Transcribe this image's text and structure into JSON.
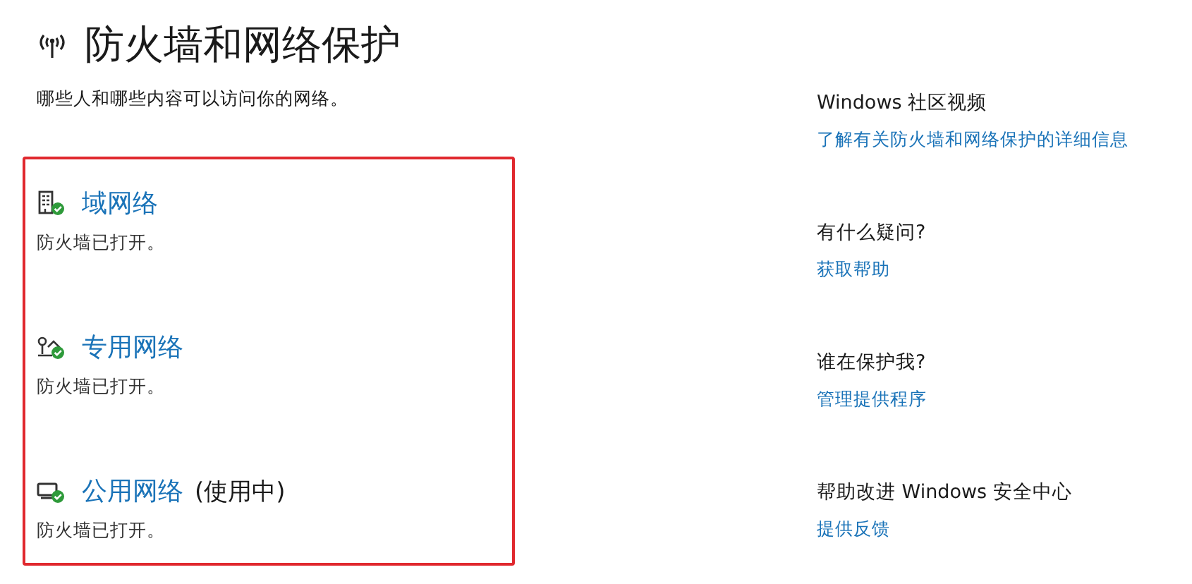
{
  "header": {
    "title": "防火墙和网络保护",
    "subtitle": "哪些人和哪些内容可以访问你的网络。"
  },
  "networks": [
    {
      "kind": "building",
      "name": "域网络",
      "status": "防火墙已打开。",
      "protected": true
    },
    {
      "kind": "home",
      "name": "专用网络",
      "status": "防火墙已打开。",
      "protected": true
    },
    {
      "kind": "monitor",
      "name": "公用网络",
      "in_use": "(使用中)",
      "status": "防火墙已打开。",
      "protected": true
    }
  ],
  "sidebar": [
    {
      "heading": "Windows 社区视频",
      "link": "了解有关防火墙和网络保护的详细信息"
    },
    {
      "heading": "有什么疑问?",
      "link": "获取帮助"
    },
    {
      "heading": "谁在保护我?",
      "link": "管理提供程序"
    },
    {
      "heading": "帮助改进 Windows 安全中心",
      "link": "提供反馈"
    }
  ]
}
